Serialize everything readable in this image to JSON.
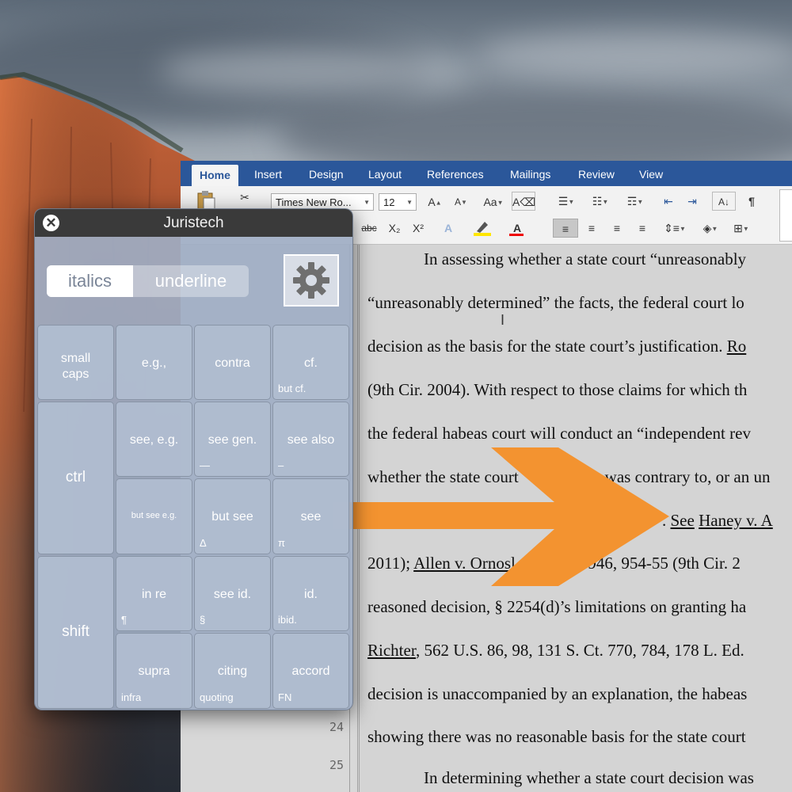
{
  "word": {
    "tabs": [
      "Home",
      "Insert",
      "Design",
      "Layout",
      "References",
      "Mailings",
      "Review",
      "View"
    ],
    "font_name": "Times New Ro...",
    "font_size": "12",
    "strikethrough_label": "abc",
    "subscript_label": "X₂",
    "superscript_label": "X²"
  },
  "document": {
    "line_numbers": [
      "24",
      "25"
    ],
    "lines": [
      [
        "In assessing whether a state court “unreasonably"
      ],
      [
        "“unreasonably determined” the facts, the federal court lo"
      ],
      [
        "decision as the basis for the state court’s justification. ",
        "Ro"
      ],
      [
        "(9th Cir. 2004). With respect to those claims for which th"
      ],
      [
        "the federal habeas court will conduct an “independent rev"
      ],
      [
        "whether the state court ",
        "n was contrary to, or an un"
      ],
      [
        ". ",
        "See",
        " ",
        "Haney v. A"
      ],
      [
        "2011); ",
        "Allen v. Ornos",
        "l",
        ".3d 946, 954-55 (9th Cir. 2"
      ],
      [
        "reasoned decision, § 2254(d)’s limitations on granting ha"
      ],
      [
        "Richter",
        ", 562 U.S. 86, 98, 131 S. Ct. 770, 784, 178 L. Ed."
      ],
      [
        "decision is unaccompanied by an explanation, the habeas"
      ],
      [
        "showing there was no reasonable basis for the state court"
      ],
      [
        "In determining whether a state court decision was"
      ]
    ]
  },
  "panel": {
    "title": "Juristech",
    "toggle": {
      "left": "italics",
      "right": "underline"
    },
    "keys": {
      "small_caps": "small\ncaps",
      "ctrl": "ctrl",
      "shift": "shift",
      "eg": "e.g.,",
      "contra": "contra",
      "cf": "cf.",
      "cf_sub": "but cf.",
      "see_eg": "see, e.g.",
      "see_gen": "see gen.",
      "see_gen_sub": "—",
      "see_also": "see also",
      "see_also_sub": "–",
      "but_see_eg": "but see e.g.",
      "but_see": "but see",
      "but_see_sub": "Δ",
      "see": "see",
      "see_sub": "π",
      "in_re": "in re",
      "in_re_sub": "¶",
      "see_id": "see id.",
      "see_id_sub": "§",
      "id": "id.",
      "id_sub": "ibid.",
      "supra": "supra",
      "supra_sub": "infra",
      "citing": "citing",
      "citing_sub": "quoting",
      "accord": "accord",
      "accord_sub": "FN"
    }
  },
  "colors": {
    "ribbon_blue": "#2b579a",
    "arrow_orange": "#f39330",
    "panel_title_bar": "#3a3a3a"
  },
  "icons": [
    "close-icon",
    "gear-icon",
    "scissors-icon",
    "paste-icon",
    "bullets-icon",
    "numbering-icon",
    "pilcrow-icon",
    "align-left-icon",
    "align-center-icon",
    "align-right-icon",
    "justify-icon",
    "highlighter-icon",
    "font-color-icon"
  ]
}
